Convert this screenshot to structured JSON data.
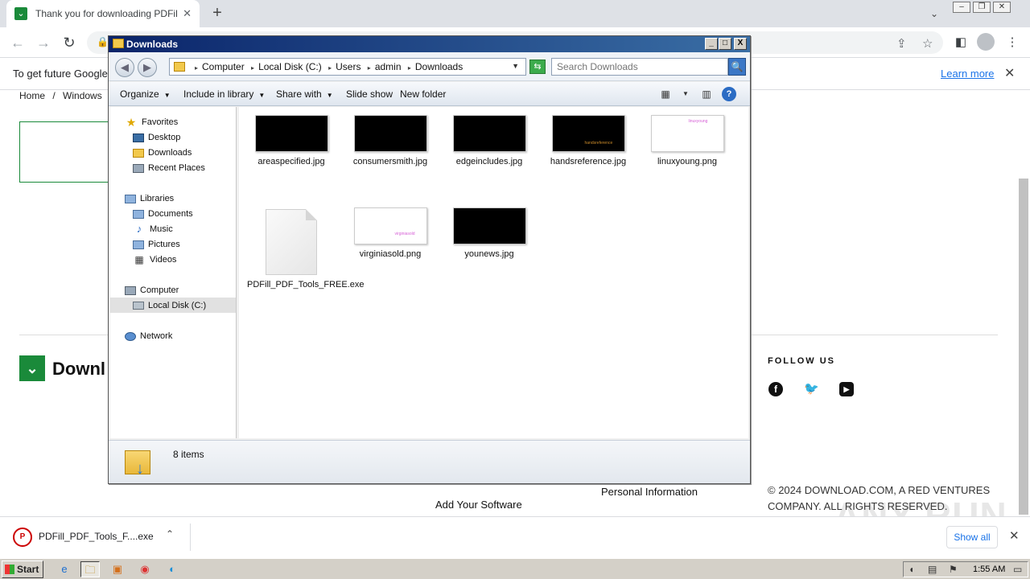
{
  "browser": {
    "tab_title": "Thank you for downloading PDFill Fr",
    "tab_close": "✕",
    "new_tab": "+",
    "tab_dropdown": "⌄",
    "win_controls": [
      "–",
      "❐",
      "✕"
    ],
    "nav": {
      "back": "←",
      "forward": "→",
      "reload": "↻"
    },
    "omnibox": {
      "lock": "🔒",
      "share": "⇪",
      "star": "☆"
    },
    "side_panel": "◧",
    "menu": "⋮"
  },
  "infobar": {
    "message": "To get future Google",
    "learn_more": "Learn more",
    "close": "✕"
  },
  "page": {
    "breadcrumb": [
      "Home",
      "/",
      "Windows"
    ],
    "site_logo": "⌄",
    "site_name": "Downl",
    "follow_us": "FOLLOW US",
    "social": {
      "facebook": "f",
      "twitter": "🐦",
      "youtube": "▶"
    },
    "personal_information": "Personal Information",
    "add_your_software": "Add Your Software",
    "copyright": "© 2024 DOWNLOAD.COM, A RED VENTURES COMPANY. ALL RIGHTS RESERVED.",
    "watermark": "ANY RUN"
  },
  "download_bar": {
    "file": "PDFill_PDF_Tools_F....exe",
    "chevron": "⌃",
    "show_all": "Show all",
    "close": "✕"
  },
  "taskbar": {
    "start": "Start",
    "apps": [
      "e",
      "🗀",
      "▣",
      "◉",
      "◐"
    ],
    "time": "1:55 AM"
  },
  "explorer": {
    "title": "Downloads",
    "title_buttons": [
      "_",
      "□",
      "X"
    ],
    "nav": {
      "back": "◀",
      "forward": "▶"
    },
    "path": [
      "Computer",
      "Local Disk (C:)",
      "Users",
      "admin",
      "Downloads"
    ],
    "path_sep": "▸",
    "path_dropdown": "▼",
    "refresh": "⇆",
    "search_placeholder": "Search Downloads",
    "search_button": "🔍",
    "commands": {
      "organize": "Organize",
      "include_in_library": "Include in library",
      "share_with": "Share with",
      "slide_show": "Slide show",
      "new_folder": "New folder",
      "arrow": "▼"
    },
    "view_icons": {
      "views": "▦",
      "views_dd": "▼",
      "preview": "▥",
      "help": "?"
    },
    "nav_pane": {
      "favorites": "Favorites",
      "desktop": "Desktop",
      "downloads": "Downloads",
      "recent_places": "Recent Places",
      "libraries": "Libraries",
      "documents": "Documents",
      "music": "Music",
      "pictures": "Pictures",
      "videos": "Videos",
      "computer": "Computer",
      "local_disk": "Local Disk (C:)",
      "network": "Network"
    },
    "files": [
      {
        "name": "areaspecified.jpg",
        "thumb": "dark"
      },
      {
        "name": "consumersmith.jpg",
        "thumb": "dark"
      },
      {
        "name": "edgeincludes.jpg",
        "thumb": "dark"
      },
      {
        "name": "handsreference.jpg",
        "thumb": "dark",
        "thumb_text": "handsreference"
      },
      {
        "name": "linuxyoung.png",
        "thumb": "light",
        "thumb_text": "linuxyoung"
      },
      {
        "name": "PDFill_PDF_Tools_FREE.exe",
        "thumb": "doc"
      },
      {
        "name": "virginiasold.png",
        "thumb": "light",
        "thumb_text": "virginiasold"
      },
      {
        "name": "younews.jpg",
        "thumb": "dark"
      }
    ],
    "item_count": "8 items"
  }
}
